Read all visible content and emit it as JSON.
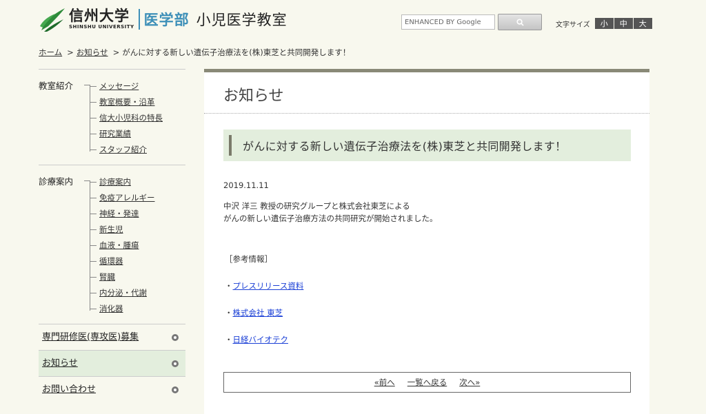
{
  "header": {
    "university_jp": "信州大学",
    "university_en": "SHINSHU UNIVERSITY",
    "department": "医学部",
    "lab": "小児医学教室",
    "search_placeholder": "ENHANCED BY Google",
    "fontsize_label": "文字サイズ",
    "fontsize_options": [
      "小",
      "中",
      "大"
    ],
    "brand_color": "#3d8fb8"
  },
  "breadcrumb": {
    "home": "ホーム",
    "news": "お知らせ",
    "current": "がんに対する新しい遺伝子治療法を(株)東芝と共同開発します！",
    "separator": ">"
  },
  "sidebar": {
    "groups": [
      {
        "title": "教室紹介",
        "items": [
          "メッセージ",
          "教室概要・沿革",
          "信大小児科の特長",
          "研究業績",
          "スタッフ紹介"
        ]
      },
      {
        "title": "診療案内",
        "items": [
          "診療案内",
          "免疫アレルギー",
          "神経・発達",
          "新生児",
          "血液・腫瘍",
          "循環器",
          "腎臓",
          "内分泌・代謝",
          "消化器"
        ]
      }
    ],
    "menu": [
      {
        "label": "専門研修医(専攻医)募集",
        "active": false
      },
      {
        "label": "お知らせ",
        "active": true
      },
      {
        "label": "お問い合わせ",
        "active": false
      }
    ]
  },
  "main": {
    "page_title": "お知らせ",
    "article_title": "がんに対する新しい遺伝子治療法を(株)東芝と共同開発します！",
    "date": "2019.11.11",
    "body_line1": "中沢 洋三 教授の研究グループと株式会社東芝による",
    "body_line2": "がんの新しい遺伝子治療方法の共同研究が開始されました。",
    "ref_title": "［参考情報］",
    "ref_links": [
      "プレスリリース資料",
      "株式会社 東芝",
      "日経バイオテク"
    ],
    "pager": {
      "prev": "«前へ",
      "list": "一覧へ戻る",
      "next": "次へ»"
    }
  }
}
